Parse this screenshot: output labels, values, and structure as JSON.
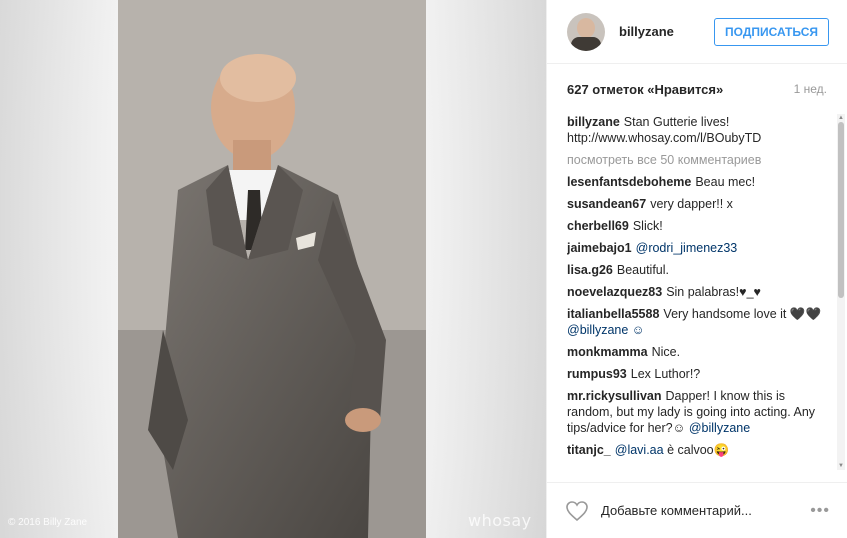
{
  "photo": {
    "copyright": "© 2016 Billy Zane",
    "watermark": "whosay"
  },
  "header": {
    "username": "billyzane",
    "follow_label": "ПОДПИСАТЬСЯ"
  },
  "meta": {
    "likes": "627 отметок «Нравится»",
    "time": "1 нед."
  },
  "caption": {
    "user": "billyzane",
    "text": "Stan Gutterie lives! http://www.whosay.com/l/BOubyTD"
  },
  "more_comments": "посмотреть все 50 комментариев",
  "comments": [
    {
      "user": "lesenfantsdeboheme",
      "text": "Beau mec!",
      "mention": ""
    },
    {
      "user": "susandean67",
      "text": "very dapper!! x",
      "mention": ""
    },
    {
      "user": "cherbell69",
      "text": "Slick!",
      "mention": ""
    },
    {
      "user": "jaimebajo1",
      "text": "",
      "mention": "@rodri_jimenez33"
    },
    {
      "user": "lisa.g26",
      "text": "Beautiful.",
      "mention": ""
    },
    {
      "user": "noevelazquez83",
      "text": "Sin palabras!♥_♥",
      "mention": ""
    },
    {
      "user": "italianbella5588",
      "text": "Very handsome love it 🖤🖤",
      "mention": "@billyzane ☺"
    },
    {
      "user": "monkmamma",
      "text": "Nice.",
      "mention": ""
    },
    {
      "user": "rumpus93",
      "text": "Lex Luthor!?",
      "mention": ""
    },
    {
      "user": "mr.rickysullivan",
      "text": "Dapper! I know this is random, but my lady is going into acting. Any tips/advice for her?☺",
      "mention": "@billyzane"
    },
    {
      "user": "titanjc_",
      "text": "è calvoo😜",
      "mention": "@lavi.aa"
    }
  ],
  "footer": {
    "add_comment": "Добавьте комментарий...",
    "more": "•••"
  }
}
